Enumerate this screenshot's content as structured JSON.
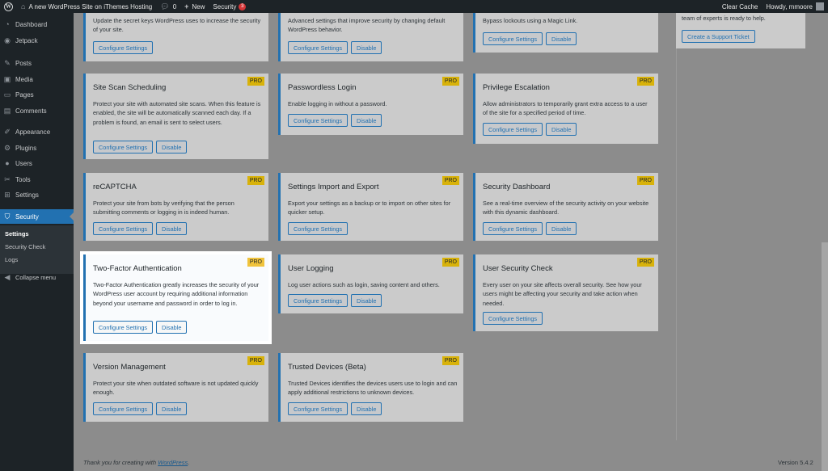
{
  "adminbar": {
    "site_name": "A new WordPress Site on iThemes Hosting",
    "comments_count": "0",
    "new_label": "New",
    "security_label": "Security",
    "security_badge": "3",
    "clear_cache": "Clear Cache",
    "howdy": "Howdy, mmoore"
  },
  "sidebar": {
    "items": [
      {
        "label": "Dashboard",
        "icon": "dashboard-icon"
      },
      {
        "label": "Jetpack",
        "icon": "jetpack-icon"
      },
      {
        "label": "Posts",
        "icon": "pin-icon"
      },
      {
        "label": "Media",
        "icon": "media-icon"
      },
      {
        "label": "Pages",
        "icon": "page-icon"
      },
      {
        "label": "Comments",
        "icon": "comment-icon"
      },
      {
        "label": "Appearance",
        "icon": "brush-icon"
      },
      {
        "label": "Plugins",
        "icon": "plugin-icon"
      },
      {
        "label": "Users",
        "icon": "user-icon"
      },
      {
        "label": "Tools",
        "icon": "wrench-icon"
      },
      {
        "label": "Settings",
        "icon": "settings-icon"
      },
      {
        "label": "Security",
        "icon": "shield-icon"
      }
    ],
    "submenu": [
      "Settings",
      "Security Check",
      "Logs"
    ],
    "collapse": "Collapse menu"
  },
  "top_partial": {
    "col1_desc": "Update the secret keys WordPress uses to increase the security of your site.",
    "col2_desc": "Advanced settings that improve security by changing default WordPress behavior.",
    "col3_desc": "Bypass lockouts using a Magic Link.",
    "support_text": "team of experts is ready to help.",
    "support_button": "Create a Support Ticket"
  },
  "buttons": {
    "configure": "Configure Settings",
    "disable": "Disable",
    "pro": "PRO"
  },
  "cards": [
    {
      "title": "Site Scan Scheduling",
      "desc": "Protect your site with automated site scans. When this feature is enabled, the site will be automatically scanned each day. If a problem is found, an email is sent to select users."
    },
    {
      "title": "Passwordless Login",
      "desc": "Enable logging in without a password."
    },
    {
      "title": "Privilege Escalation",
      "desc": "Allow administrators to temporarily grant extra access to a user of the site for a specified period of time."
    },
    {
      "title": "reCAPTCHA",
      "desc": "Protect your site from bots by verifying that the person submitting comments or logging in is indeed human."
    },
    {
      "title": "Settings Import and Export",
      "desc": "Export your settings as a backup or to import on other sites for quicker setup."
    },
    {
      "title": "Security Dashboard",
      "desc": "See a real-time overview of the security activity on your website with this dynamic dashboard."
    },
    {
      "title": "Two-Factor Authentication",
      "desc": "Two-Factor Authentication greatly increases the security of your WordPress user account by requiring additional information beyond your username and password in order to log in."
    },
    {
      "title": "User Logging",
      "desc": "Log user actions such as login, saving content and others."
    },
    {
      "title": "User Security Check",
      "desc": "Every user on your site affects overall security. See how your users might be affecting your security and take action when needed."
    },
    {
      "title": "Version Management",
      "desc": "Protect your site when outdated software is not updated quickly enough."
    },
    {
      "title": "Trusted Devices (Beta)",
      "desc": "Trusted Devices identifies the devices users use to login and can apply additional restrictions to unknown devices."
    }
  ],
  "footer": {
    "thanks_prefix": "Thank you for creating with ",
    "wp_link": "WordPress",
    "thanks_suffix": ".",
    "version": "Version 5.4.2"
  }
}
